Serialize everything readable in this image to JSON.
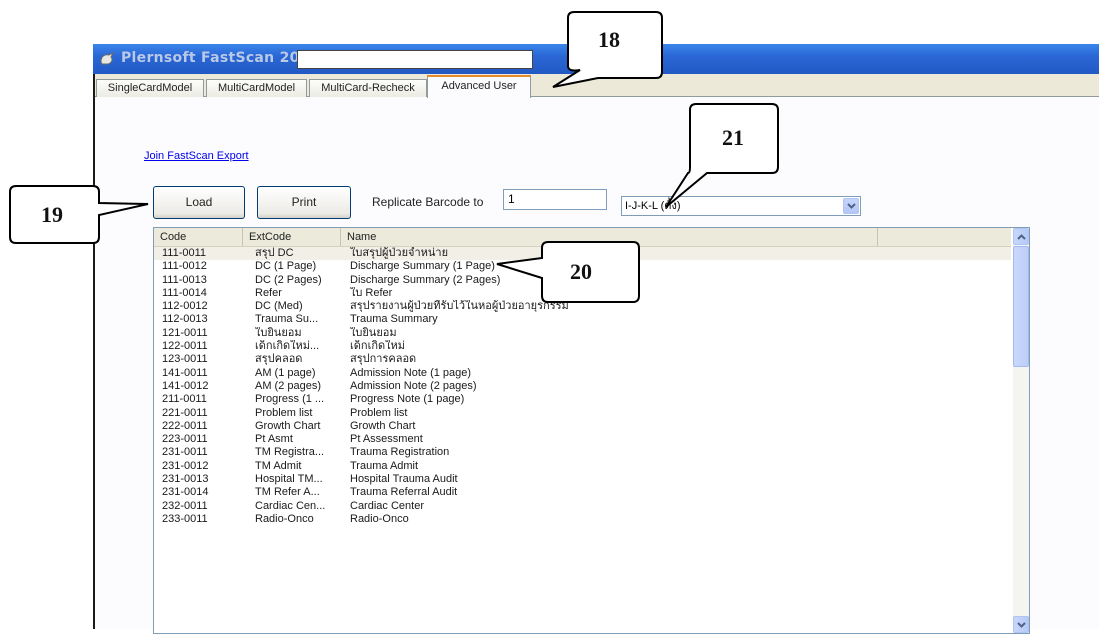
{
  "window": {
    "title": "Plernsoft FastScan 200",
    "title_field_value": ""
  },
  "tabs": [
    {
      "label": "SingleCardModel",
      "active": false
    },
    {
      "label": "MultiCardModel",
      "active": false
    },
    {
      "label": "MultiCard-Recheck",
      "active": false
    },
    {
      "label": "Advanced User",
      "active": true
    }
  ],
  "panel": {
    "export_link": "Join FastScan Export",
    "load_button": "Load",
    "print_button": "Print",
    "replicate_label": "Replicate Barcode to",
    "replicate_value": "1",
    "layout_select": "I-J-K-L (ตั้ง)"
  },
  "list": {
    "columns": [
      "Code",
      "ExtCode",
      "Name"
    ],
    "rows": [
      [
        "111-0011",
        "สรุป DC",
        "ใบสรุปผู้ป่วยจำหน่าย"
      ],
      [
        "111-0012",
        "DC (1 Page)",
        "Discharge Summary (1 Page)"
      ],
      [
        "111-0013",
        "DC (2 Pages)",
        "Discharge Summary (2 Pages)"
      ],
      [
        "111-0014",
        "Refer",
        "ใบ Refer"
      ],
      [
        "112-0012",
        "DC (Med)",
        "สรุปรายงานผู้ป่วยที่รับไว้ในหอผู้ป่วยอายุรกรรม"
      ],
      [
        "112-0013",
        "Trauma Su...",
        "Trauma Summary"
      ],
      [
        "121-0011",
        "ใบยินยอม",
        "ใบยินยอม"
      ],
      [
        "122-0011",
        "เด็กเกิดใหม่...",
        "เด็กเกิดใหม่"
      ],
      [
        "123-0011",
        "สรุปคลอด",
        "สรุปการคลอด"
      ],
      [
        "141-0011",
        "AM (1 page)",
        "Admission Note (1 page)"
      ],
      [
        "141-0012",
        "AM (2 pages)",
        "Admission Note (2 pages)"
      ],
      [
        "211-0011",
        "Progress (1 ...",
        "Progress Note (1 page)"
      ],
      [
        "221-0011",
        "Problem list",
        "Problem list"
      ],
      [
        "222-0011",
        "Growth Chart",
        "Growth Chart"
      ],
      [
        "223-0011",
        "Pt Asmt",
        "Pt Assessment"
      ],
      [
        "231-0011",
        "TM Registra...",
        "Trauma Registration"
      ],
      [
        "231-0012",
        "TM Admit",
        "Trauma  Admit"
      ],
      [
        "231-0013",
        "Hospital TM...",
        "Hospital Trauma Audit"
      ],
      [
        "231-0014",
        "TM Refer A...",
        "Trauma Referral Audit"
      ],
      [
        "232-0011",
        "Cardiac Cen...",
        "Cardiac Center"
      ],
      [
        "233-0011",
        "Radio-Onco",
        "Radio-Onco"
      ]
    ]
  },
  "callouts": {
    "c18": "18",
    "c19": "19",
    "c20": "20",
    "c21": "21"
  }
}
